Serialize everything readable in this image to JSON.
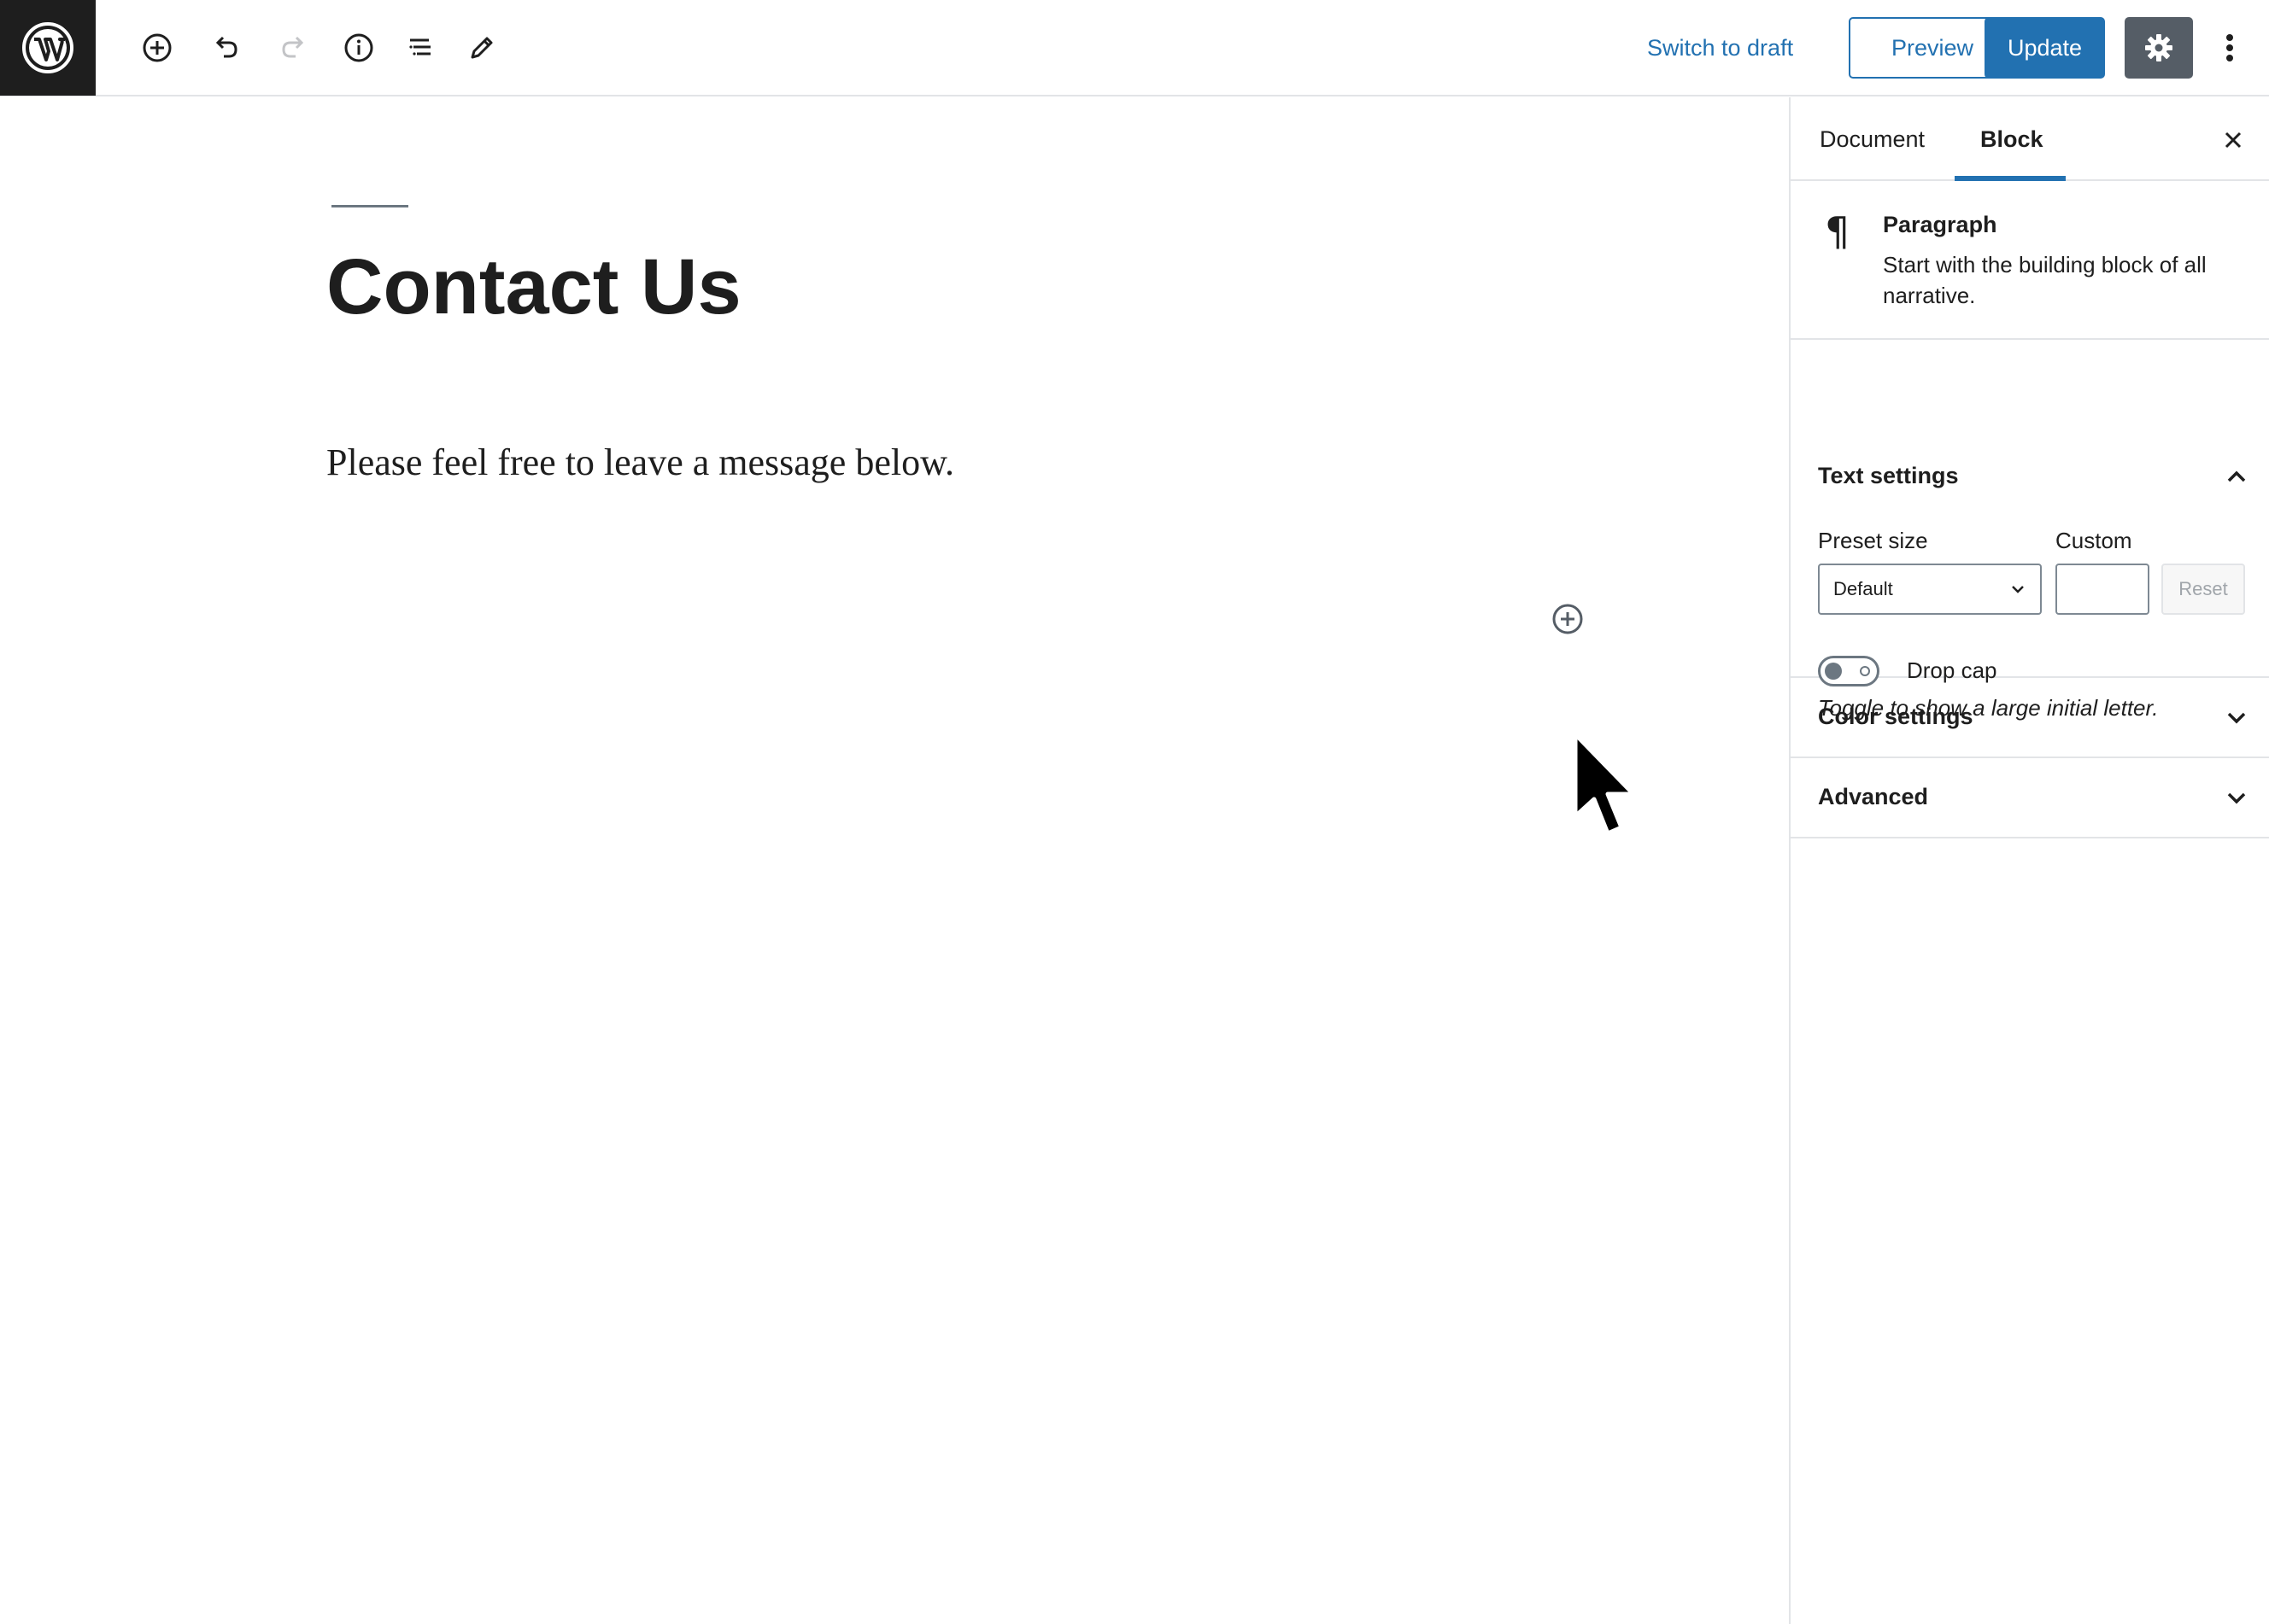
{
  "toolbar": {
    "logo_icon": "wordpress-logo-icon",
    "icons": [
      "add-block-icon",
      "undo-icon",
      "redo-icon",
      "info-icon",
      "block-navigation-icon",
      "tools-edit-icon"
    ],
    "switch_to_draft": "Switch to draft",
    "preview": "Preview",
    "update": "Update",
    "settings_icon": "gear-icon",
    "more_icon": "more-vertical-icon"
  },
  "editor": {
    "title": "Contact Us",
    "paragraph": "Please feel free to leave a message below.",
    "inserter_icon": "add-block-inline-icon"
  },
  "sidebar": {
    "tabs": [
      {
        "label": "Document",
        "active": false
      },
      {
        "label": "Block",
        "active": true
      }
    ],
    "close_icon": "close-icon",
    "block": {
      "icon": "paragraph-icon",
      "glyph": "¶",
      "name": "Paragraph",
      "description": "Start with the building block of all narrative."
    },
    "text_settings": {
      "title": "Text settings",
      "expanded": true,
      "preset_label": "Preset size",
      "preset_value": "Default",
      "custom_label": "Custom",
      "custom_value": "",
      "reset_label": "Reset",
      "drop_cap_label": "Drop cap",
      "drop_cap_enabled": false,
      "drop_cap_help": "Toggle to show a large initial letter."
    },
    "color_settings": {
      "title": "Color settings",
      "expanded": false
    },
    "advanced": {
      "title": "Advanced",
      "expanded": false
    }
  },
  "colors": {
    "accent": "#2271b1",
    "dark": "#1e1e1e",
    "settings_bg": "#555d66",
    "border": "#e2e4e7"
  }
}
